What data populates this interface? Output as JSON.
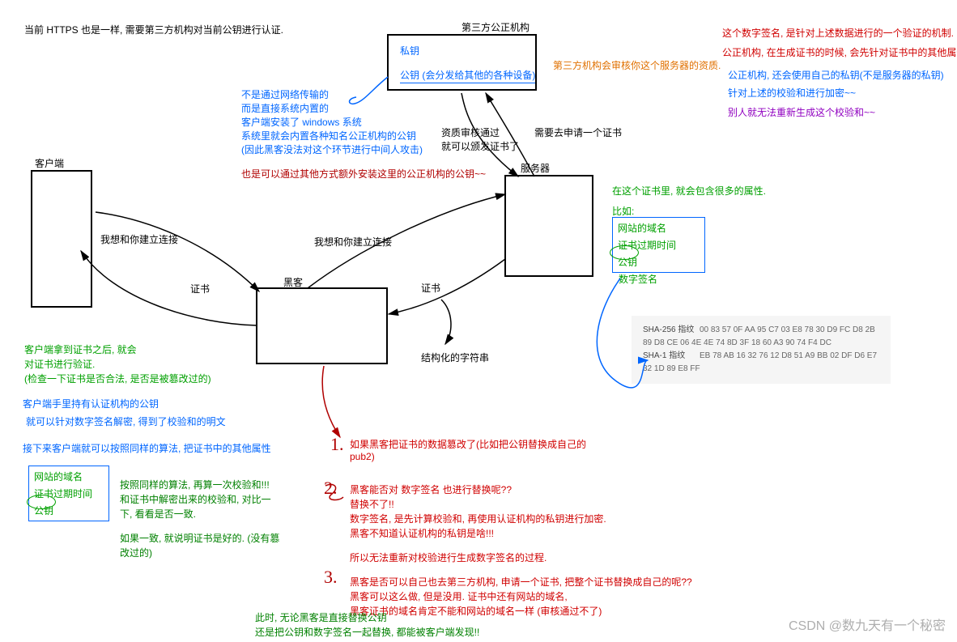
{
  "top_note": "当前 HTTPS 也是一样, 需要第三方机构对当前公钥进行认证.",
  "third_party": {
    "title": "第三方公正机构",
    "private_key": "私钥",
    "public_key": "公钥 (会分发给其他的各种设备)"
  },
  "orange_note": "第三方机构会审核你这个服务器的资质.",
  "right_notes": {
    "l1": "这个数字签名, 是针对上述数据进行的一个验证的机制.",
    "l2": "公正机构, 在生成证书的时候, 会先针对证书中的其他属性, 生",
    "l3": "公正机构, 还会使用自己的私钥(不是服务器的私钥)",
    "l4": "针对上述的校验和进行加密~~",
    "l5": "别人就无法重新生成这个校验和~~"
  },
  "blue_notes": {
    "l1": "不是通过网络传输的",
    "l2": "而是直接系统内置的",
    "l3": "客户端安装了 windows 系统",
    "l4": "系统里就会内置各种知名公正机构的公钥",
    "l5": "(因此黑客没法对这个环节进行中间人攻击)"
  },
  "red_extra": "也是可以通过其他方式额外安装这里的公正机构的公钥~~",
  "audit": {
    "l1": "资质审核通过",
    "l2": "就可以颁发证书了"
  },
  "apply_cert": "需要去申请一个证书",
  "client_label": "客户端",
  "hacker_label": "黑客",
  "server_label": "服务器",
  "cert_label_left": "证书",
  "cert_label_right": "证书",
  "struct_str": "结构化的字符串",
  "connect_left": "我想和你建立连接",
  "connect_right": "我想和你建立连接",
  "cert_contains": {
    "title": "在这个证书里, 就会包含很多的属性.",
    "eg": "比如:",
    "domain": "网站的域名",
    "expire": "证书过期时间",
    "pubkey": "公钥",
    "sig": "数字签名"
  },
  "fingerprints": {
    "sha256_lbl": "SHA-256 指纹",
    "sha256_val": "00 83 57 0F AA 95 C7 03 E8 78 30 D9 FC D8 2B 89 D8 CE 06 4E 4E 74 8D 3F 18 60 A3 90 74 F4 DC",
    "sha1_lbl": "SHA-1 指纹",
    "sha1_val": "EB 78 AB 16 32 76 12 D8 51 A9 BB 02 DF D6 E7 32 1D 89 E8 FF"
  },
  "left_green": {
    "l1": "客户端拿到证书之后, 就会",
    "l2": "对证书进行验证.",
    "l3": "(检查一下证书是否合法, 是否是被篡改过的)"
  },
  "left_blue": {
    "l1": "客户端手里持有认证机构的公钥",
    "l2": "就可以针对数字签名解密, 得到了校验和的明文",
    "l3": "接下来客户端就可以按照同样的算法, 把证书中的其他属性"
  },
  "left_green2": {
    "l1": "按照同样的算法, 再算一次校验和!!!",
    "l2": "和证书中解密出来的校验和, 对比一",
    "l3": "下, 看看是否一致.",
    "l4": "如果一致, 就说明证书是好的. (没有篡",
    "l5": "改过的)"
  },
  "small_cert": {
    "domain": "网站的域名",
    "expire": "证书过期时间",
    "pubkey": "公钥"
  },
  "red_block": {
    "q1a": "如果黑客把证书的数据篡改了(比如把公钥替换成自己的",
    "q1b": "pub2)",
    "q2a": "黑客能否对 数字签名 也进行替换呢??",
    "q2b": "替换不了!!",
    "q2c": "数字签名, 是先计算校验和, 再使用认证机构的私钥进行加密.",
    "q2d": "黑客不知道认证机构的私钥是啥!!!",
    "q2e": "所以无法重新对校验进行生成数字签名的过程.",
    "q3a": "黑客是否可以自己也去第三方机构, 申请一个证书, 把整个证书替换成自己的呢??",
    "q3b": "黑客可以这么做, 但是没用. 证书中还有网站的域名,",
    "q3c": "黑客证书的域名肯定不能和网站的域名一样 (审核通过不了)"
  },
  "bottom_green": {
    "l1": "此时, 无论黑客是直接替换公钥",
    "l2": "还是把公钥和数字签名一起替换, 都能被客户端发现!!"
  },
  "watermark": "CSDN @数九天有一个秘密"
}
